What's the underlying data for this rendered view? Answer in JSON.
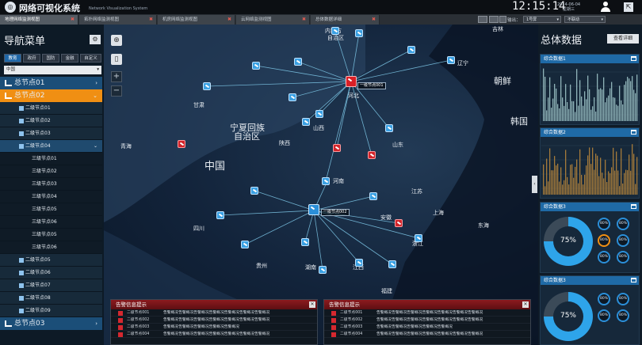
{
  "header": {
    "logo_glyph": "◎",
    "title": "网络可视化系统",
    "subtitle": "Network Visualization System",
    "time": "12:15:14",
    "date": "2014-06-04",
    "weekday": "星期三",
    "ext_glyph": "⇱"
  },
  "tabs": [
    {
      "label": "地理网络监测视图",
      "active": true
    },
    {
      "label": "拓扑网络监测视图",
      "active": false
    },
    {
      "label": "机房网络监测视图",
      "active": false
    },
    {
      "label": "云网络监测视图",
      "active": false
    },
    {
      "label": "总体数据详细",
      "active": false
    }
  ],
  "toolbar": {
    "output_label": "输出：",
    "output_value": "1号屏",
    "motion_value": "不联动"
  },
  "sidebar": {
    "title": "导航菜单",
    "gear_glyph": "⚙",
    "categories": [
      "教育",
      "政府",
      "国防",
      "金融",
      "自定义"
    ],
    "region": "中国",
    "nodes": [
      {
        "level": 1,
        "label": "总节点01",
        "arrow": "›"
      },
      {
        "level": 1,
        "label": "总节点02",
        "arrow": "⌄"
      },
      {
        "level": 2,
        "label": "二级节点01",
        "arrow": ""
      },
      {
        "level": 2,
        "label": "二级节点02",
        "arrow": ""
      },
      {
        "level": 2,
        "label": "二级节点03",
        "arrow": ""
      },
      {
        "level": 2,
        "label": "二级节点04",
        "arrow": "⌄"
      },
      {
        "level": 3,
        "label": "三级节点01"
      },
      {
        "level": 3,
        "label": "三级节点02"
      },
      {
        "level": 3,
        "label": "三级节点03"
      },
      {
        "level": 3,
        "label": "三级节点04"
      },
      {
        "level": 3,
        "label": "三级节点05"
      },
      {
        "level": 3,
        "label": "三级节点06"
      },
      {
        "level": 3,
        "label": "三级节点05"
      },
      {
        "level": 3,
        "label": "三级节点06"
      },
      {
        "level": 2,
        "label": "二级节点05",
        "arrow": ""
      },
      {
        "level": 2,
        "label": "二级节点06",
        "arrow": ""
      },
      {
        "level": 2,
        "label": "二级节点07",
        "arrow": ""
      },
      {
        "level": 2,
        "label": "二级节点08",
        "arrow": ""
      },
      {
        "level": 2,
        "label": "二级节点09",
        "arrow": ""
      },
      {
        "level": 1,
        "label": "总节点03",
        "arrow": "›"
      }
    ]
  },
  "map": {
    "controls": {
      "globe": "⊕",
      "phone": "▯",
      "zoom_in": "+",
      "zoom_out": "−"
    },
    "labels": [
      "内蒙古",
      "自治区",
      "吉林",
      "辽宁",
      "朝鲜",
      "韩国",
      "甘肃",
      "宁夏回族",
      "自治区",
      "山西",
      "河北",
      "陕西",
      "山东",
      "青海",
      "中国",
      "河南",
      "江苏",
      "安徽",
      "四川",
      "上海",
      "东海",
      "浙江",
      "贵州",
      "湖南",
      "江西",
      "福建"
    ],
    "hub1": "一级节点001",
    "hub2": "一级节点002"
  },
  "alerts": [
    {
      "title": "告警信息提示",
      "rows": [
        {
          "node": "二级节点001",
          "msg": "告警概况告警概况告警概况告警概况告警概况告警概况告警概况"
        },
        {
          "node": "二级节点002",
          "msg": "告警概况告警概况告警概况告警概况告警概况告警概况告警概况"
        },
        {
          "node": "二级节点003",
          "msg": "告警概况告警概况告警概况告警概况告警概况"
        },
        {
          "node": "二级节点004",
          "msg": "告警概况告警概况告警概况告警概况告警概况告警概况告警概况"
        }
      ]
    },
    {
      "title": "告警信息提示",
      "rows": [
        {
          "node": "二级节点001",
          "msg": "告警概况告警概况告警概况告警概况告警概况告警概况告警概况"
        },
        {
          "node": "二级节点002",
          "msg": "告警概况告警概况告警概况告警概况告警概况告警概况告警概况"
        },
        {
          "node": "二级节点003",
          "msg": "告警概况告警概况告警概况告警概况告警概况"
        },
        {
          "node": "二级节点004",
          "msg": "告警概况告警概况告警概况告警概况告警概况告警概况告警概况"
        }
      ]
    }
  ],
  "right": {
    "title": "总体数据",
    "detail": "查看详细",
    "panels": [
      {
        "title": "综合数据1",
        "kind": "bars",
        "color": "#8fb3b8"
      },
      {
        "title": "综合数据2",
        "kind": "bars",
        "color": "#a47a3a"
      },
      {
        "title": "综合数据3",
        "kind": "gauge",
        "main": "75%",
        "main_level": 0.75,
        "rings": [
          "80%",
          "80%",
          "80%",
          "80%",
          "80%",
          "80%"
        ]
      },
      {
        "title": "综合数据3",
        "kind": "gauge",
        "main": "75%",
        "main_level": 0.75,
        "rings": [
          "80%",
          "80%",
          "80%",
          "80%"
        ]
      }
    ]
  },
  "colors": {
    "accent": "#1f6aa6",
    "orange": "#f08f13",
    "alarm": "#d2242a",
    "link": "#7ec8e8"
  }
}
